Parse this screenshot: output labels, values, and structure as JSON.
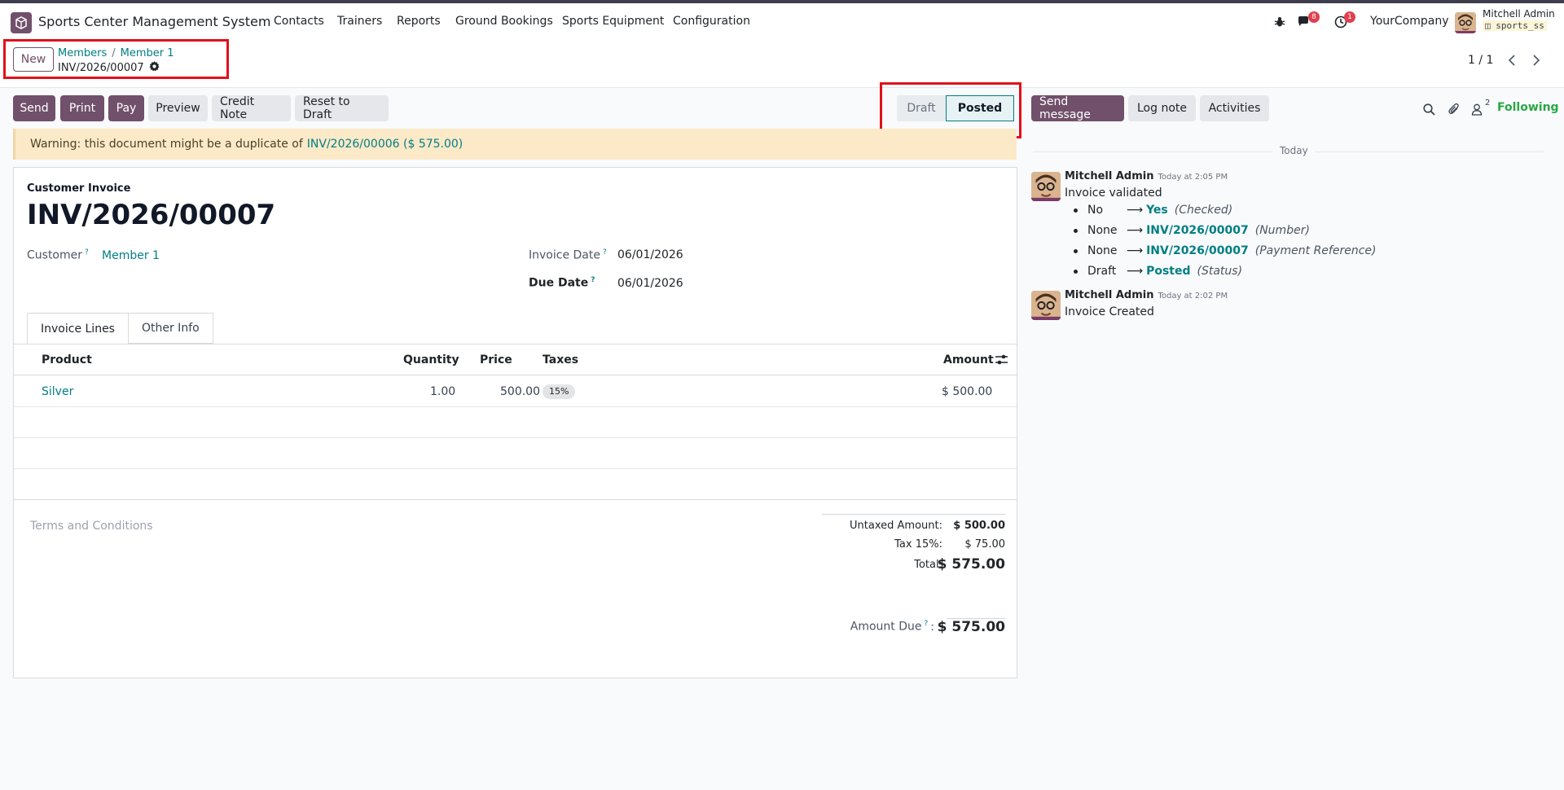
{
  "navbar": {
    "app_name": "Sports Center Management System",
    "menu": [
      "Contacts",
      "Trainers",
      "Reports",
      "Ground Bookings",
      "Sports Equipment",
      "Configuration"
    ],
    "chat_badge": "8",
    "activity_badge": "1",
    "company": "YourCompany",
    "user_name": "Mitchell Admin",
    "db_name": "sports_ss"
  },
  "control_panel": {
    "new_label": "New",
    "breadcrumb_parent": "Members",
    "breadcrumb_current": "Member 1",
    "record_name": "INV/2026/00007",
    "pager": "1 / 1"
  },
  "actions": {
    "send": "Send",
    "print": "Print",
    "pay": "Pay",
    "preview": "Preview",
    "credit_note": "Credit Note",
    "reset_draft": "Reset to Draft"
  },
  "status": {
    "draft": "Draft",
    "posted": "Posted"
  },
  "warning": {
    "text": "Warning: this document might be a duplicate of",
    "link": "INV/2026/00006 ($ 575.00)"
  },
  "invoice": {
    "kind": "Customer Invoice",
    "number": "INV/2026/00007",
    "customer_label": "Customer",
    "customer": "Member 1",
    "invoice_date_label": "Invoice Date",
    "invoice_date": "06/01/2026",
    "due_date_label": "Due Date",
    "due_date": "06/01/2026",
    "help_mark": "?"
  },
  "tabs": [
    "Invoice Lines",
    "Other Info"
  ],
  "lines": {
    "headers": {
      "product": "Product",
      "quantity": "Quantity",
      "price": "Price",
      "taxes": "Taxes",
      "amount": "Amount"
    },
    "rows": [
      {
        "product": "Silver",
        "quantity": "1.00",
        "price": "500.00",
        "tax": "15%",
        "amount": "$ 500.00"
      }
    ]
  },
  "terms_placeholder": "Terms and Conditions",
  "totals": {
    "untaxed_label": "Untaxed Amount:",
    "untaxed": "$ 500.00",
    "tax_label": "Tax 15%:",
    "tax": "$ 75.00",
    "total_label": "Total:",
    "total": "$ 575.00",
    "due_label": "Amount Due",
    "due_suffix": ":",
    "due": "$ 575.00"
  },
  "chatter": {
    "send_message": "Send message",
    "log_note": "Log note",
    "activities": "Activities",
    "followers_count": "2",
    "following": "Following",
    "today": "Today",
    "messages": [
      {
        "author": "Mitchell Admin",
        "time": "Today at 2:05 PM",
        "body": "Invoice validated",
        "tracking": [
          {
            "old": "No",
            "new": "Yes",
            "field": "(Checked)"
          },
          {
            "old": "None",
            "new": "INV/2026/00007",
            "field": "(Number)"
          },
          {
            "old": "None",
            "new": "INV/2026/00007",
            "field": "(Payment Reference)"
          },
          {
            "old": "Draft",
            "new": "Posted",
            "field": "(Status)"
          }
        ]
      },
      {
        "author": "Mitchell Admin",
        "time": "Today at 2:02 PM",
        "body": "Invoice Created"
      }
    ]
  },
  "colors": {
    "brand": "#71506b",
    "link": "#017e84",
    "highlight_box": "#e0101b",
    "following": "#28a745"
  }
}
